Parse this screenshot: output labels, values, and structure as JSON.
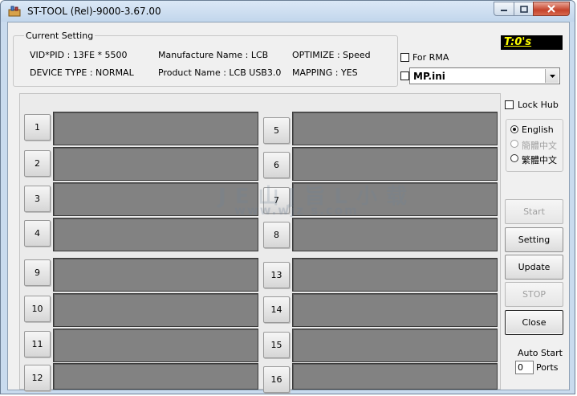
{
  "window": {
    "title": "ST-TOOL (Rel)-9000-3.67.00"
  },
  "current_setting": {
    "group_label": "Current Setting",
    "vid_pid": "VID*PID : 13FE * 5500",
    "device_type": "DEVICE TYPE : NORMAL",
    "manufacture_name": "Manufacture Name : LCB",
    "product_name": "Product Name : LCB USB3.0",
    "optimize": "OPTIMIZE : Speed",
    "mapping": "MAPPING : YES"
  },
  "timer": "T:0's",
  "for_rma": {
    "label": "For RMA",
    "checked": false
  },
  "ini_select": {
    "value": "MP.ini"
  },
  "lock_hub": {
    "label": "Lock Hub",
    "checked": false
  },
  "language": {
    "options": [
      {
        "label": "English",
        "selected": true,
        "enabled": true
      },
      {
        "label": "簡體中文",
        "selected": false,
        "enabled": false
      },
      {
        "label": "繁體中文",
        "selected": false,
        "enabled": true
      }
    ]
  },
  "ports": {
    "left": [
      "1",
      "2",
      "3",
      "4",
      "9",
      "10",
      "11",
      "12"
    ],
    "right": [
      "5",
      "6",
      "7",
      "8",
      "13",
      "14",
      "15",
      "16"
    ]
  },
  "buttons": {
    "start": "Start",
    "setting": "Setting",
    "update": "Update",
    "stop": "STOP",
    "close": "Close"
  },
  "auto_start": {
    "label": "Auto Start",
    "value": "0",
    "ports_label": "Ports"
  },
  "watermark": {
    "line1": "J E 山 J 旨 L 小 载",
    "line2": "www.wjz s.com"
  },
  "colors": {
    "timer_bg": "#000000",
    "timer_fg": "#ffff00",
    "port_bar": "#828282"
  }
}
